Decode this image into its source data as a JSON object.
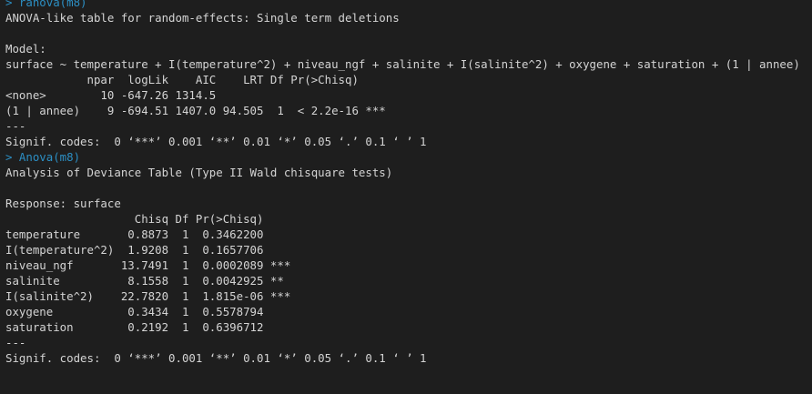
{
  "console": {
    "lines": [
      {
        "kind": "cmd",
        "text": "> ranova(m8)"
      },
      {
        "kind": "out",
        "text": "ANOVA-like table for random-effects: Single term deletions"
      },
      {
        "kind": "out",
        "text": ""
      },
      {
        "kind": "out",
        "text": "Model:"
      },
      {
        "kind": "out",
        "text": "surface ~ temperature + I(temperature^2) + niveau_ngf + salinite + I(salinite^2) + oxygene + saturation + (1 | annee)"
      },
      {
        "kind": "out",
        "text": "            npar  logLik    AIC    LRT Df Pr(>Chisq)    "
      },
      {
        "kind": "out",
        "text": "<none>        10 -647.26 1314.5                         "
      },
      {
        "kind": "out",
        "text": "(1 | annee)    9 -694.51 1407.0 94.505  1  < 2.2e-16 ***"
      },
      {
        "kind": "out",
        "text": "---"
      },
      {
        "kind": "out",
        "text": "Signif. codes:  0 ‘***’ 0.001 ‘**’ 0.01 ‘*’ 0.05 ‘.’ 0.1 ‘ ’ 1"
      },
      {
        "kind": "cmd",
        "text": "> Anova(m8)"
      },
      {
        "kind": "out",
        "text": "Analysis of Deviance Table (Type II Wald chisquare tests)"
      },
      {
        "kind": "out",
        "text": ""
      },
      {
        "kind": "out",
        "text": "Response: surface"
      },
      {
        "kind": "out",
        "text": "                   Chisq Df Pr(>Chisq)    "
      },
      {
        "kind": "out",
        "text": "temperature       0.8873  1  0.3462200    "
      },
      {
        "kind": "out",
        "text": "I(temperature^2)  1.9208  1  0.1657706    "
      },
      {
        "kind": "out",
        "text": "niveau_ngf       13.7491  1  0.0002089 ***"
      },
      {
        "kind": "out",
        "text": "salinite          8.1558  1  0.0042925 ** "
      },
      {
        "kind": "out",
        "text": "I(salinite^2)    22.7820  1  1.815e-06 ***"
      },
      {
        "kind": "out",
        "text": "oxygene           0.3434  1  0.5578794    "
      },
      {
        "kind": "out",
        "text": "saturation        0.2192  1  0.6396712    "
      },
      {
        "kind": "out",
        "text": "---"
      },
      {
        "kind": "out",
        "text": "Signif. codes:  0 ‘***’ 0.001 ‘**’ 0.01 ‘*’ 0.05 ‘.’ 0.1 ‘ ’ 1"
      }
    ]
  }
}
